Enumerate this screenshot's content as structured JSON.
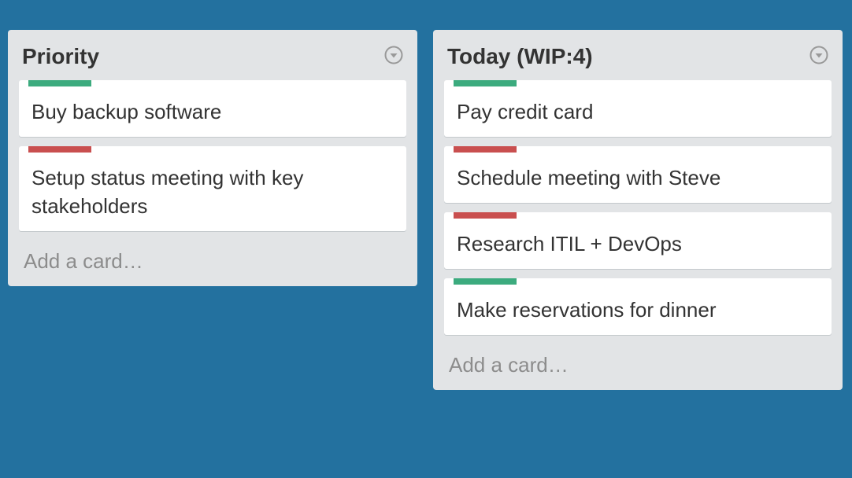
{
  "board": {
    "lists": [
      {
        "title": "Priority",
        "menu_icon": "chevron-down-circle-icon",
        "cards": [
          {
            "title": "Buy backup software",
            "label_color": "#3cab7e"
          },
          {
            "title": "Setup status meeting with key stakeholders",
            "label_color": "#c94f4f"
          }
        ],
        "add_card": "Add a card…"
      },
      {
        "title": "Today (WIP:4)",
        "menu_icon": "chevron-down-circle-icon",
        "cards": [
          {
            "title": "Pay credit card",
            "label_color": "#3cab7e"
          },
          {
            "title": "Schedule meeting with Steve",
            "label_color": "#c94f4f"
          },
          {
            "title": "Research ITIL + DevOps",
            "label_color": "#c94f4f"
          },
          {
            "title": "Make reservations for dinner",
            "label_color": "#3cab7e"
          }
        ],
        "add_card": "Add a card…"
      }
    ]
  },
  "colors": {
    "board_background": "#23719f",
    "list_background": "#e2e4e6",
    "card_background": "#ffffff",
    "label_green": "#3cab7e",
    "label_red": "#c94f4f"
  }
}
